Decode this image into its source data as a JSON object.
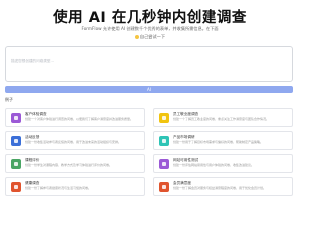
{
  "hero": {
    "title": "使用 AI 在几秒钟内创建调查",
    "subtitle": "FormFlow 允许使用 AI 创建数千个优秀的表单，并收集所需信息。在下面",
    "try_link": "自己尝试一下"
  },
  "prompt": {
    "placeholder": "描述您想创建的问卷类型..."
  },
  "generate_button": {
    "label": "AI"
  },
  "examples": {
    "label": "例子",
    "cards": [
      {
        "title": "客户体验调查",
        "desc": "创建一个对客户体验进行调查的问卷，以便我们了解客户满意度并改进服务质量。",
        "color": "#9b59d6"
      },
      {
        "title": "员工敬业度调查",
        "desc": "创建一个了解员工敬业度的问卷，重点关注工作满意度与团队合作情况。",
        "color": "#f1c40f"
      },
      {
        "title": "活动反馈",
        "desc": "创建一份收集活动参与者反馈的问卷，用于改进未来的活动组织与安排。",
        "color": "#3b6fd8"
      },
      {
        "title": "产品市场调研",
        "desc": "创建一份用于了解目标市场需求与偏好的问卷，帮助制定产品策略。",
        "color": "#2ec4b6"
      },
      {
        "title": "课程评价",
        "desc": "创建一份学生对课程内容、教学方式及学习体验进行评价的问卷。",
        "color": "#4aa564"
      },
      {
        "title": "网站可用性测试",
        "desc": "创建一份评估网站易用性与用户体验的问卷，收集改进建议。",
        "color": "#9b59d6"
      },
      {
        "title": "健康调查",
        "desc": "创建一份了解参与者健康状况与生活习惯的问卷。",
        "color": "#e0542e"
      },
      {
        "title": "会员满意度",
        "desc": "创建一份了解会员对服务与权益满意程度的问卷，用于优化会员计划。",
        "color": "#e0542e"
      }
    ]
  }
}
